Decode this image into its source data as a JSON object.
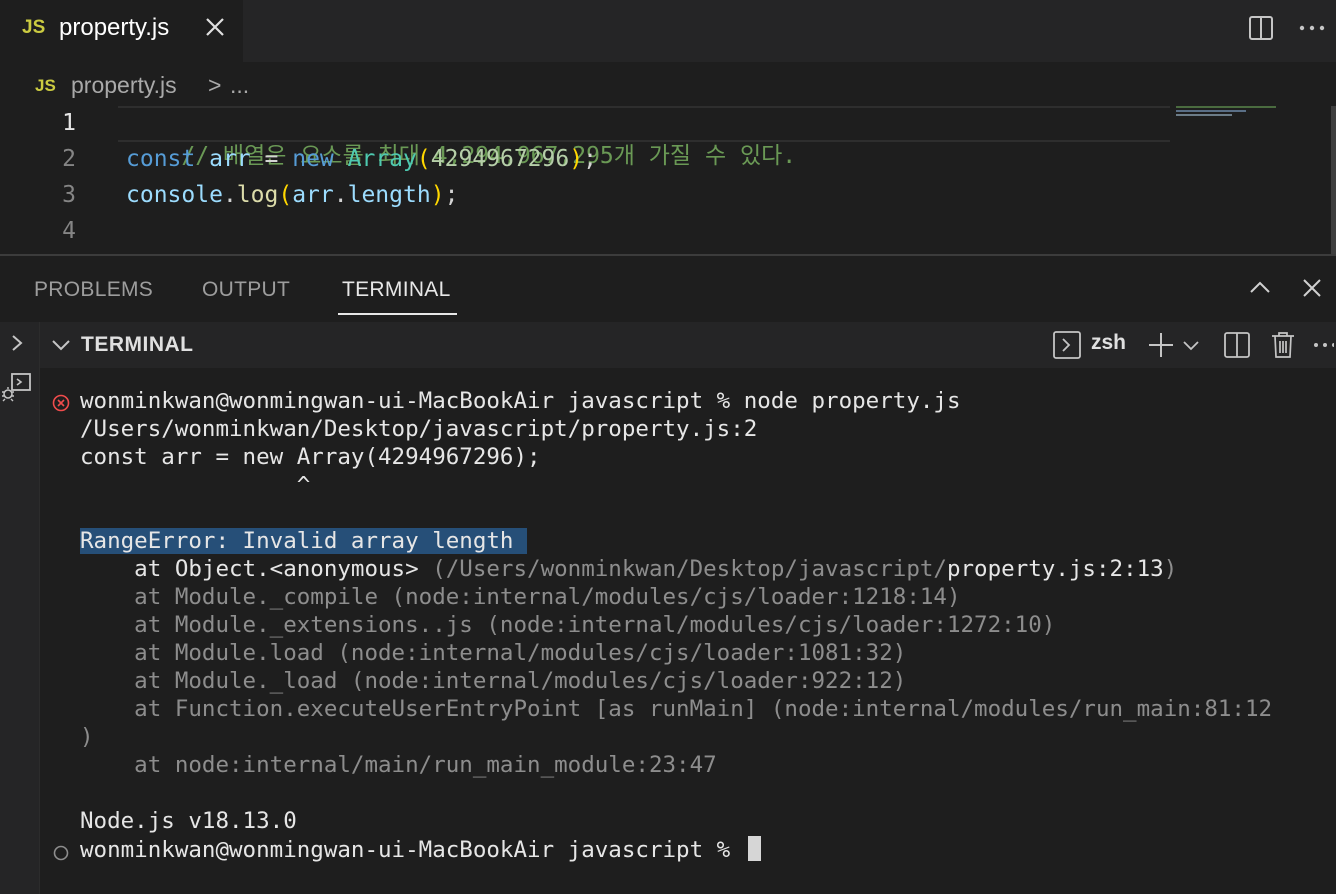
{
  "tab": {
    "icon_label": "JS",
    "file_name": "property.js"
  },
  "breadcrumb": {
    "icon_label": "JS",
    "file": "property.js",
    "separator": ">",
    "ellipsis": "..."
  },
  "editor": {
    "line_numbers": [
      "1",
      "2",
      "3",
      "4"
    ],
    "line1_comment": "// 배열은 요소를 최대 4,294,967,295개 가질 수 있다.",
    "line2": {
      "kw1": "const",
      "var": "arr",
      "eq": "=",
      "kw2": "new",
      "cls": "Array",
      "open": "(",
      "num": "4294967296",
      "close": ")",
      "semi": ";"
    },
    "line3": {
      "obj": "console",
      "dot1": ".",
      "fn": "log",
      "open": "(",
      "var": "arr",
      "dot2": ".",
      "prop": "length",
      "close": ")",
      "semi": ";"
    }
  },
  "panel": {
    "tabs": [
      "PROBLEMS",
      "OUTPUT",
      "TERMINAL"
    ],
    "active_tab": "TERMINAL"
  },
  "terminal": {
    "header_title": "TERMINAL",
    "shell_name": "zsh",
    "lines": {
      "cmd1": "wonminkwan@wonmingwan-ui-MacBookAir javascript % node property.js",
      "path": "/Users/wonminkwan/Desktop/javascript/property.js:2",
      "src": "const arr = new Array(4294967296);",
      "caret": "                ^",
      "error": "RangeError: Invalid array length ",
      "stack1_prefix": "    at Object.<anonymous> ",
      "stack1_dim": "(/Users/wonminkwan/Desktop/javascript/",
      "stack1_file": "property.js:2:13",
      "stack1_close": ")",
      "stack2": "    at Module._compile (node:internal/modules/cjs/loader:1218:14)",
      "stack3": "    at Module._extensions..js (node:internal/modules/cjs/loader:1272:10)",
      "stack4": "    at Module.load (node:internal/modules/cjs/loader:1081:32)",
      "stack5": "    at Module._load (node:internal/modules/cjs/loader:922:12)",
      "stack6": "    at Function.executeUserEntryPoint [as runMain] (node:internal/modules/run_main:81:12",
      "stack6_wrap": ")",
      "stack7": "    at node:internal/main/run_main_module:23:47",
      "node_version": "Node.js v18.13.0",
      "prompt": "wonminkwan@wonmingwan-ui-MacBookAir javascript % "
    }
  },
  "colors": {
    "error_deco": "#f14c4c",
    "selection": "#264f78",
    "comment": "#6a9955",
    "keyword": "#569cd6"
  }
}
